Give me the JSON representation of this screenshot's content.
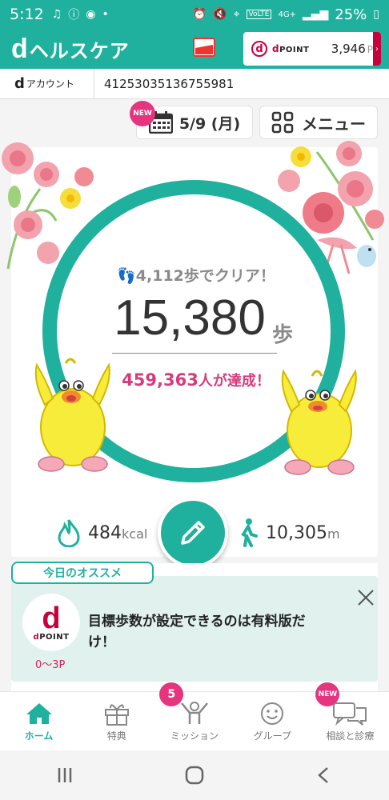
{
  "statusbar": {
    "time": "5:12",
    "battery": "25%",
    "network": "4G+",
    "volte": "VoLTE"
  },
  "header": {
    "brand_d": "d",
    "brand_text": "ヘルスケア",
    "dpoint_label": "POINT",
    "dpoint_value": "3,946",
    "dpoint_unit": "P"
  },
  "account": {
    "label_d": "d",
    "label": "アカウント",
    "id": "41253035136755981"
  },
  "date": {
    "badge": "NEW",
    "label": "5/9 (月)"
  },
  "menu": {
    "label": "メニュー"
  },
  "main": {
    "goal_text": "4,112歩でクリア！",
    "steps": "15,380",
    "steps_unit": "歩",
    "achieved_number": "459,363",
    "achieved_text": "人が達成！",
    "kcal_value": "484",
    "kcal_unit": "kcal",
    "distance_value": "10,305",
    "distance_unit": "m",
    "progress": 1.0
  },
  "recommend": {
    "tag": "今日のオススメ",
    "logo_d": "d",
    "logo_label": "POINT",
    "points": "0〜3P",
    "text": "目標歩数が設定できるのは有料版だけ！"
  },
  "nav": [
    {
      "label": "ホーム",
      "active": true
    },
    {
      "label": "特典",
      "badge": "5"
    },
    {
      "label": "ミッション",
      "badge": "NEW"
    },
    {
      "label": "グループ"
    },
    {
      "label": "相談と診療"
    }
  ],
  "colors": {
    "primary": "#1fb19e",
    "accent": "#e6357f",
    "docomo_red": "#c7003e"
  }
}
